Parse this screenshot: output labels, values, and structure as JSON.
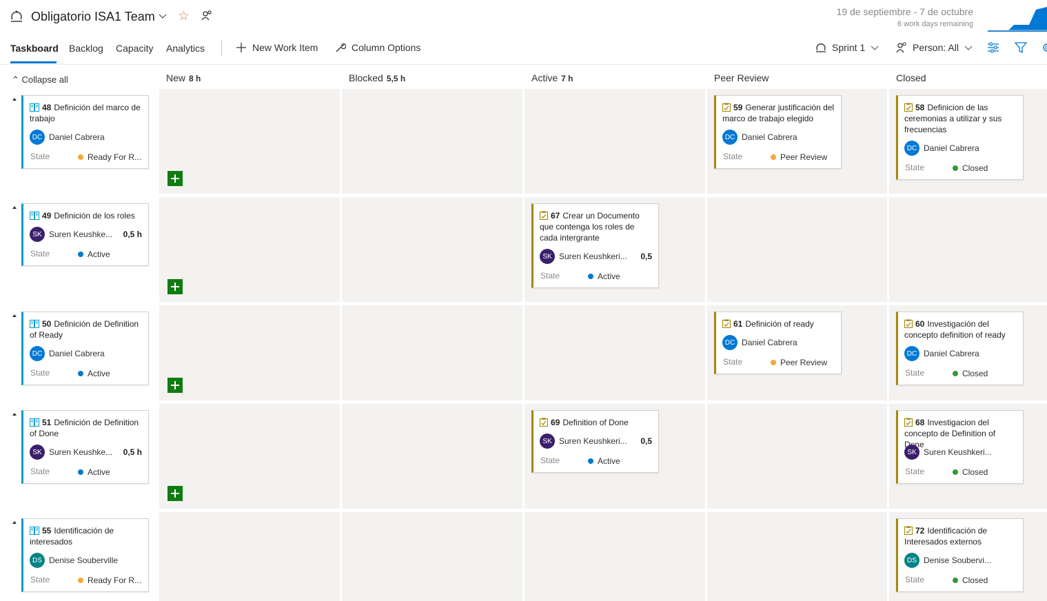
{
  "header": {
    "team_name": "Obligatorio ISA1 Team",
    "sprint_dates": "19 de septiembre - 7 de octubre",
    "work_days_remaining": "6 work days remaining"
  },
  "toolbar": {
    "tabs": [
      {
        "label": "Taskboard",
        "selected": true
      },
      {
        "label": "Backlog",
        "selected": false
      },
      {
        "label": "Capacity",
        "selected": false
      },
      {
        "label": "Analytics",
        "selected": false
      }
    ],
    "new_work_item": "New Work Item",
    "column_options": "Column Options",
    "sprint": "Sprint 1",
    "person_filter": "Person: All"
  },
  "board": {
    "collapse_all": "Collapse all",
    "state_label": "State",
    "columns": [
      {
        "name": "New",
        "hours": "8 h"
      },
      {
        "name": "Blocked",
        "hours": "5,5 h"
      },
      {
        "name": "Active",
        "hours": "7 h"
      },
      {
        "name": "Peer Review",
        "hours": ""
      },
      {
        "name": "Closed",
        "hours": ""
      }
    ],
    "rows": [
      {
        "story": {
          "id": "48",
          "title": "Definición del marco de trabajo",
          "assignee": "Daniel Cabrera",
          "initials": "DC",
          "hours": "",
          "state": "Ready For R..."
        },
        "tasks": [
          {
            "col": 3,
            "id": "59",
            "title": "Generar justificación del marco de trabajo elegido",
            "assignee": "Daniel Cabrera",
            "initials": "DC",
            "hours": "",
            "state": "Peer Review"
          },
          {
            "col": 4,
            "id": "58",
            "title": "Definicion de las ceremonias a utilizar y sus frecuencias",
            "assignee": "Daniel Cabrera",
            "initials": "DC",
            "hours": "",
            "state": "Closed"
          }
        ]
      },
      {
        "story": {
          "id": "49",
          "title": "Definición de los roles",
          "assignee": "Suren Keushke...",
          "initials": "SK",
          "hours": "0,5 h",
          "state": "Active"
        },
        "tasks": [
          {
            "col": 2,
            "id": "67",
            "title": "Crear un Documento que contenga los roles de cada intergrante",
            "assignee": "Suren Keushkeri...",
            "initials": "SK",
            "hours": "0,5",
            "state": "Active"
          }
        ]
      },
      {
        "story": {
          "id": "50",
          "title": "Definición de Definition of Ready",
          "assignee": "Daniel Cabrera",
          "initials": "DC",
          "hours": "",
          "state": "Active"
        },
        "tasks": [
          {
            "col": 3,
            "id": "61",
            "title": "Definición of ready",
            "assignee": "Daniel Cabrera",
            "initials": "DC",
            "hours": "",
            "state": "Peer Review"
          },
          {
            "col": 4,
            "id": "60",
            "title": "Investigación del concepto definition of ready",
            "assignee": "Daniel Cabrera",
            "initials": "DC",
            "hours": "",
            "state": "Closed"
          }
        ]
      },
      {
        "story": {
          "id": "51",
          "title": "Definición de Definition of Done",
          "assignee": "Suren Keushke...",
          "initials": "SK",
          "hours": "0,5 h",
          "state": "Active"
        },
        "tasks": [
          {
            "col": 2,
            "id": "69",
            "title": "Definition of Done",
            "assignee": "Suren Keushkeri...",
            "initials": "SK",
            "hours": "0,5",
            "state": "Active"
          },
          {
            "col": 4,
            "id": "68",
            "title": "Investigacion del concepto de Definition of Done",
            "assignee": "Suren Keushkeri...",
            "initials": "SK",
            "hours": "",
            "state": "Closed"
          }
        ]
      },
      {
        "story": {
          "id": "55",
          "title": "Identificación de interesados",
          "assignee": "Denise Souberville",
          "initials": "DS",
          "hours": "",
          "state": "Ready For R..."
        },
        "tasks": [
          {
            "col": 4,
            "id": "72",
            "title": "Identificación de Interesados externos",
            "assignee": "Denise Soubervi...",
            "initials": "DS",
            "hours": "",
            "state": "Closed"
          }
        ]
      }
    ]
  },
  "colors": {
    "accent": "#0078d4",
    "story_bar": "#009ccc",
    "task_bar": "#a4880a",
    "add_button": "#107c10",
    "state_active": "#007acc",
    "state_ready": "#f2a83b",
    "state_peer_review": "#f2a83b",
    "state_closed": "#339933",
    "avatar_DC": "#0078d4",
    "avatar_SK": "#3b1f6b",
    "avatar_DS": "#038387"
  },
  "icons": {
    "team": "team-icon",
    "favorite": "star-icon",
    "members": "people-icon",
    "new_item": "plus-icon",
    "column_options": "wrench-icon",
    "sprint": "sprint-icon",
    "person": "person-icon",
    "settings": "sliders-icon",
    "filter": "filter-icon",
    "story": "book-icon",
    "task": "clipboard-icon",
    "add": "add-task-icon"
  }
}
